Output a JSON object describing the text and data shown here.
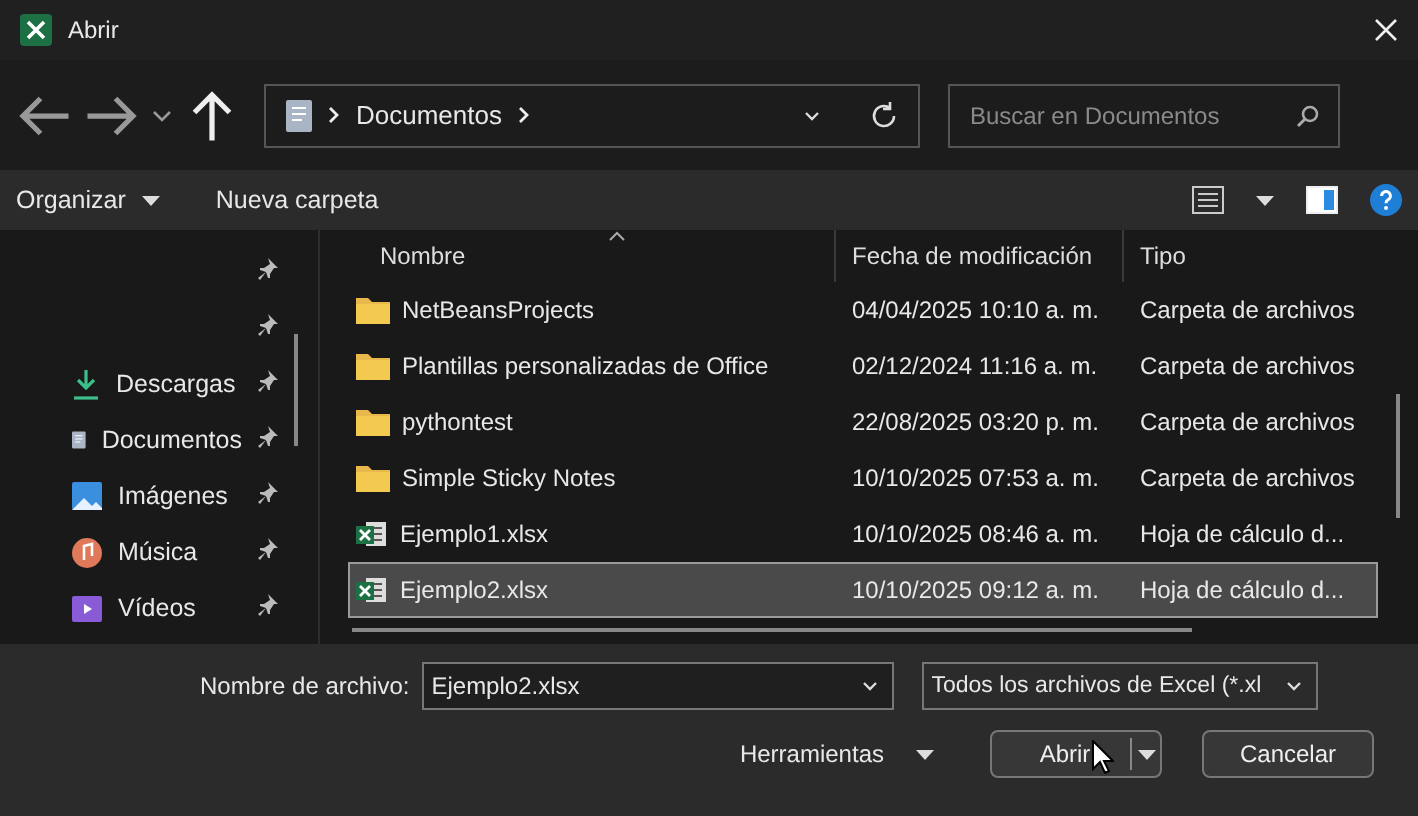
{
  "window": {
    "title": "Abrir"
  },
  "address": {
    "path": [
      "Documentos"
    ]
  },
  "search": {
    "placeholder": "Buscar en Documentos"
  },
  "toolbar": {
    "organize": "Organizar",
    "new_folder": "Nueva carpeta"
  },
  "sidebar": {
    "items": [
      {
        "pinned": true
      },
      {
        "pinned": true
      },
      {
        "label": "Descargas",
        "kind": "downloads",
        "pinned": true
      },
      {
        "label": "Documentos",
        "kind": "documents",
        "pinned": true
      },
      {
        "label": "Imágenes",
        "kind": "pictures",
        "pinned": true
      },
      {
        "label": "Música",
        "kind": "music",
        "pinned": true
      },
      {
        "label": "Vídeos",
        "kind": "videos",
        "pinned": true
      }
    ]
  },
  "table": {
    "columns": [
      "Nombre",
      "Fecha de modificación",
      "Tipo"
    ],
    "rows": [
      {
        "kind": "folder",
        "name": "NetBeansProjects",
        "date": "04/04/2025 10:10 a. m.",
        "type": "Carpeta de archivos",
        "selected": false
      },
      {
        "kind": "folder",
        "name": "Plantillas personalizadas de Office",
        "date": "02/12/2024 11:16 a. m.",
        "type": "Carpeta de archivos",
        "selected": false
      },
      {
        "kind": "folder",
        "name": "pythontest",
        "date": "22/08/2025 03:20 p. m.",
        "type": "Carpeta de archivos",
        "selected": false
      },
      {
        "kind": "folder",
        "name": "Simple Sticky Notes",
        "date": "10/10/2025 07:53 a. m.",
        "type": "Carpeta de archivos",
        "selected": false
      },
      {
        "kind": "excel",
        "name": "Ejemplo1.xlsx",
        "date": "10/10/2025 08:46 a. m.",
        "type": "Hoja de cálculo d...",
        "selected": false
      },
      {
        "kind": "excel",
        "name": "Ejemplo2.xlsx",
        "date": "10/10/2025 09:12 a. m.",
        "type": "Hoja de cálculo d...",
        "selected": true
      }
    ]
  },
  "footer": {
    "filename_label": "Nombre de archivo:",
    "filename": "Ejemplo2.xlsx",
    "filter": "Todos los archivos de Excel (*.xl",
    "tools": "Herramientas",
    "open": "Abrir",
    "cancel": "Cancelar"
  }
}
